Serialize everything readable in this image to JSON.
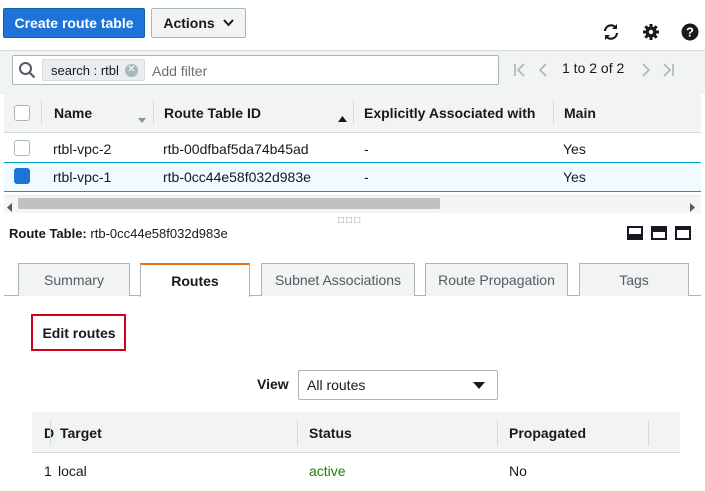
{
  "toolbar": {
    "create_label": "Create route table",
    "actions_label": "Actions"
  },
  "filter": {
    "token_label": "search : rtbl",
    "placeholder": "Add filter"
  },
  "pagination": {
    "range": "1 to 2 of 2"
  },
  "table": {
    "columns": [
      "Name",
      "Route Table ID",
      "Explicitly Associated with",
      "Main"
    ],
    "rows": [
      {
        "name": "rtbl-vpc-2",
        "id": "rtb-00dfbaf5da74b45ad",
        "assoc": "-",
        "main": "Yes",
        "selected": false
      },
      {
        "name": "rtbl-vpc-1",
        "id": "rtb-0cc44e58f032d983e",
        "assoc": "-",
        "main": "Yes",
        "selected": true
      }
    ]
  },
  "detail": {
    "title_label": "Route Table:",
    "title_value": "rtb-0cc44e58f032d983e"
  },
  "tabs": [
    "Summary",
    "Routes",
    "Subnet Associations",
    "Route Propagation",
    "Tags"
  ],
  "active_tab": "Routes",
  "routes": {
    "edit_label": "Edit routes",
    "view_label": "View",
    "view_value": "All routes",
    "columns": [
      "D",
      "Target",
      "Status",
      "Propagated"
    ],
    "rows": [
      {
        "dest": "1",
        "target": "local",
        "status": "active",
        "propagated": "No"
      }
    ],
    "status_color": "#1d8102"
  },
  "colors": {
    "primary": "#1e73d8",
    "highlight": "#d0021b",
    "tab_accent": "#ec7211"
  }
}
